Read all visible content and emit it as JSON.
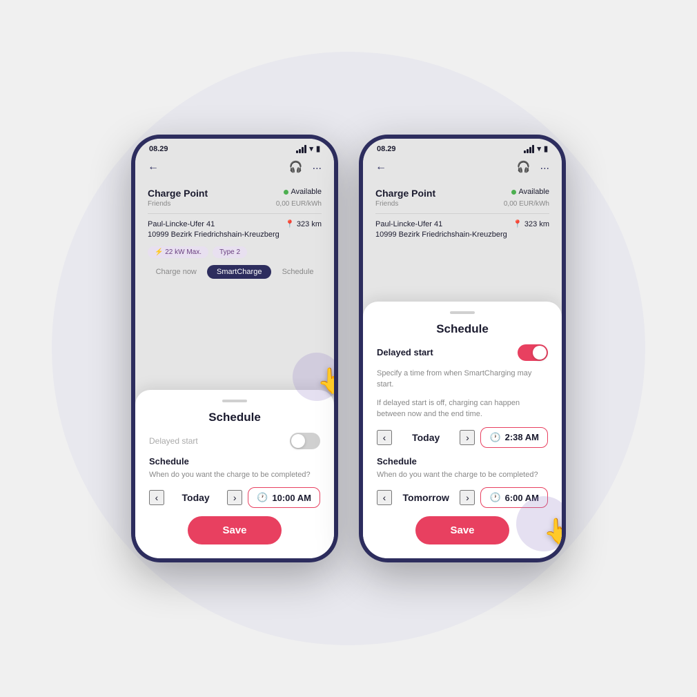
{
  "page": {
    "background_circle_color": "#e0dfe8"
  },
  "phone_left": {
    "status_bar": {
      "time": "08.29"
    },
    "header": {
      "back_label": "←",
      "support_icon": "headphones",
      "more_icon": "..."
    },
    "charge_point": {
      "title": "Charge Point",
      "status": "Available",
      "subtitle": "Friends",
      "price": "0,00 EUR/kWh",
      "address_line1": "Paul-Lincke-Ufer 41",
      "address_line2": "10999 Bezirk Friedrichshain-Kreuzberg",
      "distance": "323 km",
      "tag1": "⚡ 22 kW Max.",
      "tag2": "Type 2"
    },
    "nav_tabs": {
      "tab1": "Charge now",
      "tab2": "SmartCharge",
      "tab3": "Schedule"
    },
    "bottom_sheet": {
      "title": "Schedule",
      "delayed_start_label": "Delayed start",
      "toggle_state": "off",
      "schedule_section_label": "Schedule",
      "schedule_description": "When do you want the charge to be completed?",
      "day_prev_arrow": "‹",
      "day_next_arrow": "›",
      "day_value": "Today",
      "time_value": "10:00 AM",
      "save_button": "Save"
    }
  },
  "phone_right": {
    "status_bar": {
      "time": "08.29"
    },
    "header": {
      "back_label": "←",
      "support_icon": "headphones",
      "more_icon": "..."
    },
    "charge_point": {
      "title": "Charge Point",
      "status": "Available",
      "subtitle": "Friends",
      "price": "0,00 EUR/kWh",
      "address_line1": "Paul-Lincke-Ufer 41",
      "address_line2": "10999 Bezirk Friedrichshain-Kreuzberg",
      "distance": "323 km"
    },
    "bottom_sheet": {
      "title": "Schedule",
      "delayed_start_label": "Delayed start",
      "toggle_state": "on",
      "delayed_start_desc1": "Specify a time from when SmartCharging may start.",
      "delayed_start_desc2": "If delayed start is off, charging can happen between now and the end time.",
      "day_start_prev": "‹",
      "day_start_next": "›",
      "day_start_value": "Today",
      "time_start_value": "2:38 AM",
      "schedule_section_label": "Schedule",
      "schedule_description": "When do you want the charge to be completed?",
      "day_end_prev": "‹",
      "day_end_next": "›",
      "day_end_value": "Tomorrow",
      "time_end_value": "6:00 AM",
      "save_button": "Save"
    }
  }
}
